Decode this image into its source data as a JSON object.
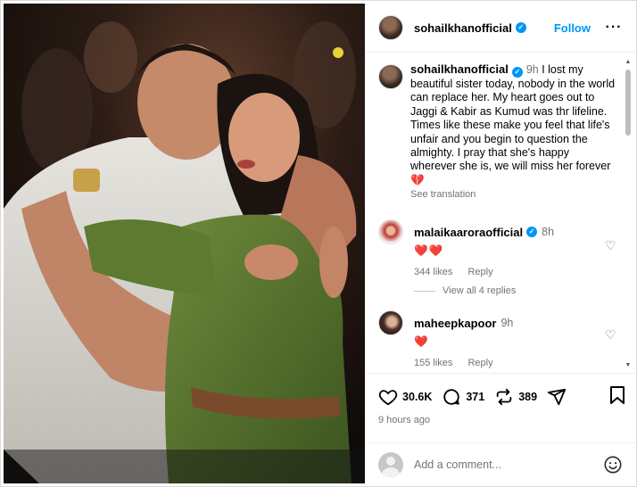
{
  "post": {
    "author": "sohailkhanofficial",
    "follow_label": "Follow",
    "more_icon": "more-horizontal-icon"
  },
  "caption": {
    "author": "sohailkhanofficial",
    "time": "9h",
    "text": "I lost my beautiful sister today, nobody in the world can replace her. My heart goes out to Jaggi & Kabir as Kumud was thr lifeline. Times like these make you feel that life's unfair and you begin to question the almighty. I pray that she's happy wherever she is, we will miss her forever 💔",
    "see_translation": "See translation"
  },
  "comments": [
    {
      "user": "malaikaaroraofficial",
      "time": "8h",
      "text": "❤️❤️",
      "likes": "344 likes",
      "reply_label": "Reply"
    },
    {
      "user": "maheepkapoor",
      "time": "9h",
      "text": "❤️",
      "likes": "155 likes",
      "reply_label": "Reply"
    }
  ],
  "view_replies": "View all 4 replies",
  "actions": {
    "likes": "30.6K",
    "comments": "371",
    "reposts": "389"
  },
  "posted_ago": "9 hours ago",
  "comment_input": {
    "placeholder": "Add a comment..."
  },
  "colors": {
    "accent": "#0095f6",
    "muted": "#737373",
    "heart": "#e0245e"
  }
}
